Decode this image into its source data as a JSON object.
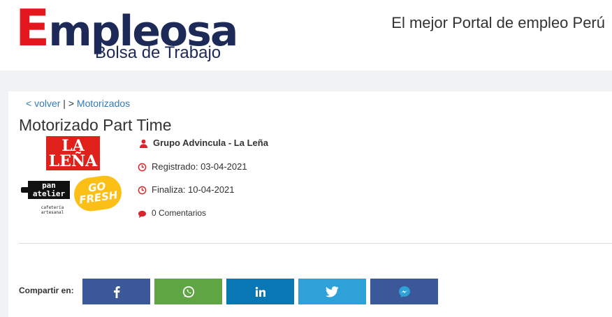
{
  "header": {
    "logo": {
      "brand_initial": "E",
      "brand_rest": "mpleosa",
      "subtitle": "Bolsa de Trabajo"
    },
    "tagline": "El mejor Portal de empleo Perú"
  },
  "breadcrumb": {
    "back_label": "< volver",
    "separator": " | > ",
    "category_label": "Motorizados"
  },
  "job": {
    "title": "Motorizado Part Time",
    "company": "Grupo Advincula - La Leña",
    "registered": "Registrado: 03-04-2021",
    "ends": "Finaliza: 10-04-2021",
    "comments": "0 Comentarios"
  },
  "company_logos": {
    "lalena_line1": "LA",
    "lalena_line2": "LEÑA",
    "pan_line1": "pan",
    "pan_line2": "atelier",
    "pan_sub1": "cafetería",
    "pan_sub2": "artesanal",
    "gofresh_line1": "GO",
    "gofresh_line2": "FRESH"
  },
  "share": {
    "label": "Compartir en:",
    "buttons": [
      {
        "name": "facebook",
        "icon": "facebook-icon",
        "color": "#3b5998"
      },
      {
        "name": "whatsapp",
        "icon": "whatsapp-icon",
        "color": "#5fa544"
      },
      {
        "name": "linkedin",
        "icon": "linkedin-icon",
        "color": "#0a77b5"
      },
      {
        "name": "twitter",
        "icon": "twitter-icon",
        "color": "#2ea1d8"
      },
      {
        "name": "messenger",
        "icon": "messenger-icon",
        "color": "#3b5998"
      }
    ]
  },
  "colors": {
    "accent_red": "#d9262b",
    "link_blue": "#337ab7",
    "brand_navy": "#1d2a57",
    "brand_red": "#e3171d"
  }
}
